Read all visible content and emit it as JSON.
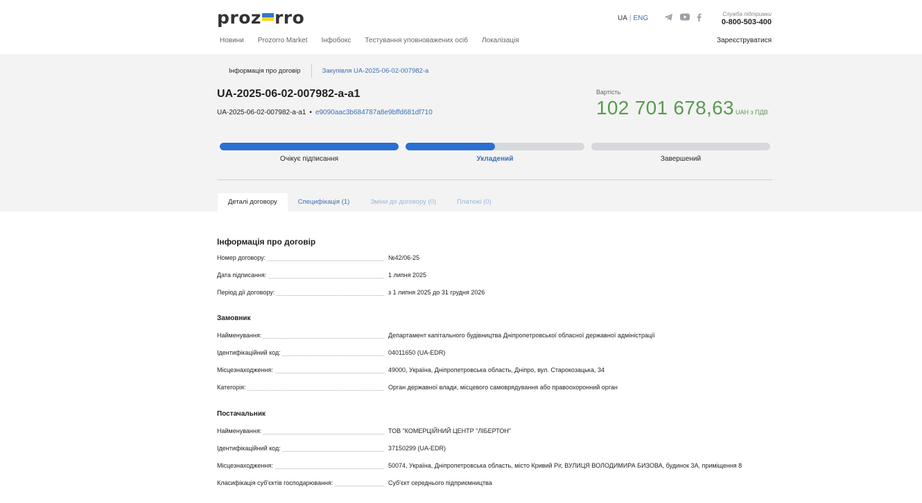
{
  "header": {
    "logo_text_left": "proz",
    "logo_text_right": "rro",
    "logo_flag_colors": [
      "#3a75c4",
      "#f9d616"
    ],
    "lang": {
      "ua": "UA",
      "sep": "|",
      "eng": "ENG"
    },
    "social_icons": [
      "telegram-icon",
      "youtube-icon",
      "facebook-icon"
    ],
    "support_label": "Служба підтримки",
    "support_phone": "0-800-503-400",
    "nav": [
      "Новини",
      "Prozorro Market",
      "Інфобокс",
      "Тестування уповноважених осіб",
      "Локалізація"
    ],
    "register": "Зареєструватися"
  },
  "breadcrumbs": {
    "current": "Інформація про договір",
    "link": "Закупівля UA-2025-06-02-007982-a"
  },
  "contract": {
    "title": "UA-2025-06-02-007982-a-a1",
    "sub_id": "UA-2025-06-02-007982-a-a1",
    "dot": "•",
    "hash": "e9090aac3b684787a8e9bffd681df710",
    "value_label": "Вартість",
    "amount": "102 701 678,63",
    "currency": "UAH з ПДВ"
  },
  "progress": [
    {
      "label": "Очікує підписання",
      "fill": 1.0,
      "active": false
    },
    {
      "label": "Укладений",
      "fill": 0.5,
      "active": true
    },
    {
      "label": "Завершений",
      "fill": 0.0,
      "active": false
    }
  ],
  "tabs": [
    {
      "label": "Деталі договору",
      "state": "active"
    },
    {
      "label": "Специфікація (1)",
      "state": "link"
    },
    {
      "label": "Зміни до договору (0)",
      "state": "muted"
    },
    {
      "label": "Платежі (0)",
      "state": "muted"
    }
  ],
  "info": {
    "title": "Інформація про договір",
    "rows": [
      {
        "k": "Номер договору:",
        "v": "№42/06-25"
      },
      {
        "k": "Дата підписання:",
        "v": "1 липня 2025"
      },
      {
        "k": "Період дії договору:",
        "v": "з 1 липня 2025 до 31 грудня 2026"
      }
    ]
  },
  "customer": {
    "title": "Замовник",
    "rows": [
      {
        "k": "Найменування:",
        "v": "Департамент капітального будівництва Дніпропетровської обласної державної адміністрації"
      },
      {
        "k": "Ідентифікаційний код:",
        "v": "04011650 (UA-EDR)"
      },
      {
        "k": "Місцезнаходження:",
        "v": "49000, Україна, Дніпропетровська область, Дніпро, вул. Старокозацька, 34"
      },
      {
        "k": "Категорія:",
        "v": "Орган державної влади, місцевого самоврядування або правоохоронний орган"
      }
    ]
  },
  "supplier": {
    "title": "Постачальник",
    "rows": [
      {
        "k": "Найменування:",
        "v": "ТОВ \"КОМЕРЦІЙНИЙ ЦЕНТР \"ЛІБЕРТОН\""
      },
      {
        "k": "Ідентифікаційний код:",
        "v": "37150299 (UA-EDR)"
      },
      {
        "k": "Місцезнаходження:",
        "v": "50074, Україна, Дніпропетровська область, місто Кривий Ріг, ВУЛИЦЯ ВОЛОДИМИРА БИЗОВА, будинок 3А, приміщення 8"
      },
      {
        "k": "Класифікація суб'єктів господарювання:",
        "v": "Суб'єкт середнього підприємництва"
      }
    ]
  }
}
